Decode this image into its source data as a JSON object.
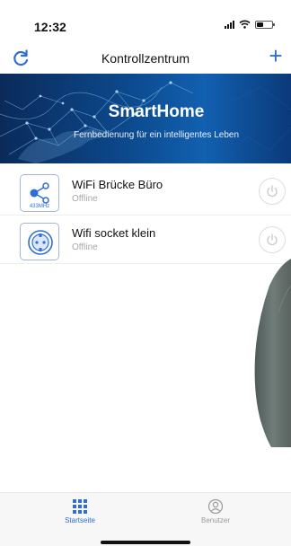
{
  "status_bar": {
    "time": "12:32"
  },
  "nav": {
    "title": "Kontrollzentrum",
    "add_symbol": "+"
  },
  "banner": {
    "title": "SmartHome",
    "subtitle": "Fernbedienung für ein intelligentes Leben"
  },
  "devices": [
    {
      "name": "WiFi Brücke Büro",
      "status": "Offline",
      "icon": "bridge-share-icon",
      "icon_label": "433MHz"
    },
    {
      "name": "Wifi socket klein",
      "status": "Offline",
      "icon": "socket-icon"
    }
  ],
  "tabs": [
    {
      "label": "Startseite",
      "icon": "grid-icon",
      "active": true
    },
    {
      "label": "Benutzer",
      "icon": "user-icon",
      "active": false
    }
  ],
  "colors": {
    "accent": "#2d6ed8",
    "banner": "#0c4a8e",
    "muted": "#a8a8a8"
  }
}
